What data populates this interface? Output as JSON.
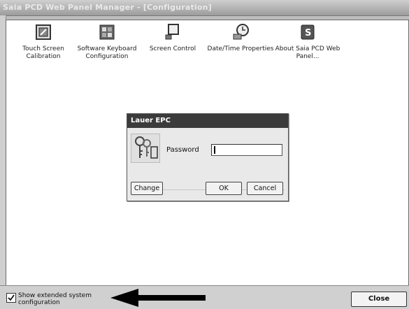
{
  "window": {
    "title": "Saia PCD Web Panel Manager - [Configuration]"
  },
  "icons": [
    {
      "label": "Touch Screen Calibration",
      "icon": "touch-calibration-icon"
    },
    {
      "label": "Software Keyboard Configuration",
      "icon": "keyboard-icon"
    },
    {
      "label": "Screen Control",
      "icon": "screen-icon"
    },
    {
      "label": "Date/Time Properties",
      "icon": "clock-icon"
    },
    {
      "label": "About Saia PCD Web Panel...",
      "icon": "about-icon"
    }
  ],
  "dialog": {
    "title": "Lauer EPC",
    "password_label": "Password",
    "password_value": "",
    "buttons": {
      "change": "Change",
      "ok": "OK",
      "cancel": "Cancel"
    }
  },
  "footer": {
    "checkbox_label": "Show extended system configuration",
    "checkbox_checked": true,
    "close_label": "Close"
  }
}
